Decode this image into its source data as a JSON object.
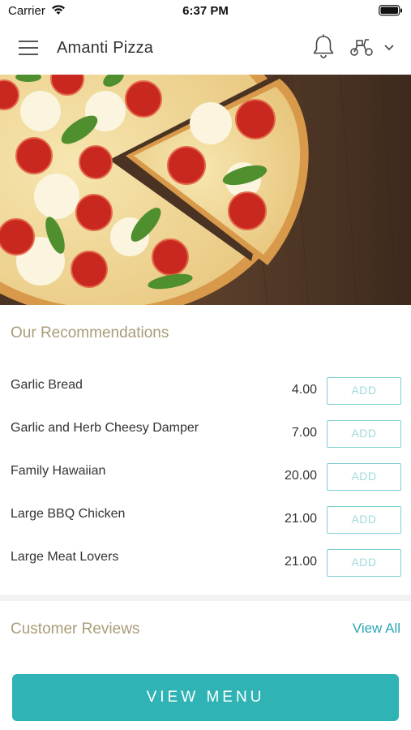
{
  "status_bar": {
    "carrier": "Carrier",
    "time": "6:37 PM"
  },
  "header": {
    "title": "Amanti Pizza",
    "icons": [
      "hamburger-menu-icon",
      "bell-icon",
      "scooter-icon",
      "chevron-down-icon"
    ]
  },
  "hero": {
    "image": "pizza-with-tomatoes-basil-mozzarella"
  },
  "recommendations": {
    "title": "Our Recommendations",
    "items": [
      {
        "name": "Garlic Bread",
        "price": "4.00",
        "button": "ADD"
      },
      {
        "name": "Garlic and Herb Cheesy Damper",
        "price": "7.00",
        "button": "ADD"
      },
      {
        "name": "Family Hawaiian",
        "price": "20.00",
        "button": "ADD"
      },
      {
        "name": "Large BBQ Chicken",
        "price": "21.00",
        "button": "ADD"
      },
      {
        "name": "Large Meat Lovers",
        "price": "21.00",
        "button": "ADD"
      }
    ]
  },
  "reviews": {
    "title": "Customer Reviews",
    "view_all": "View All"
  },
  "footer": {
    "button": "VIEW MENU"
  },
  "colors": {
    "accent": "#30b3b5",
    "section_title": "#a99c78",
    "add_border": "#7fd0d1"
  }
}
